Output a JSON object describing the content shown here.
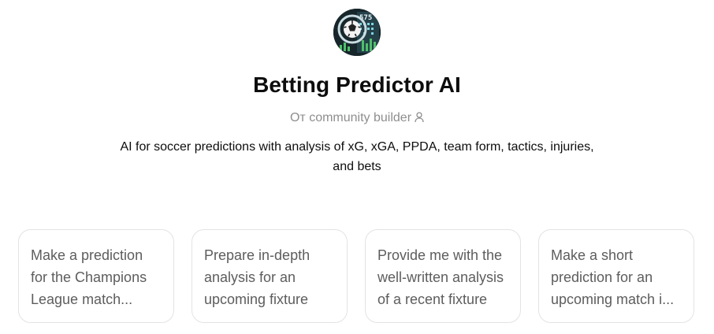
{
  "gpt": {
    "name": "Betting Predictor AI",
    "author_label": "От community builder",
    "description": "AI for soccer predictions with analysis of xG, xGA, PPDA, team form, tactics, injuries, and bets",
    "avatar_icon": "soccer-ball-stats-avatar"
  },
  "starters": [
    {
      "label": "Make a prediction for the Champions League match..."
    },
    {
      "label": "Prepare in-depth analysis for an upcoming fixture"
    },
    {
      "label": "Provide me with the well-written analysis of a recent fixture"
    },
    {
      "label": "Make a short prediction for an upcoming match i..."
    }
  ],
  "colors": {
    "title": "#0d0d0d",
    "muted": "#8e8e8e",
    "card_text": "#5d5d5d",
    "card_border": "#e3e3e3"
  }
}
